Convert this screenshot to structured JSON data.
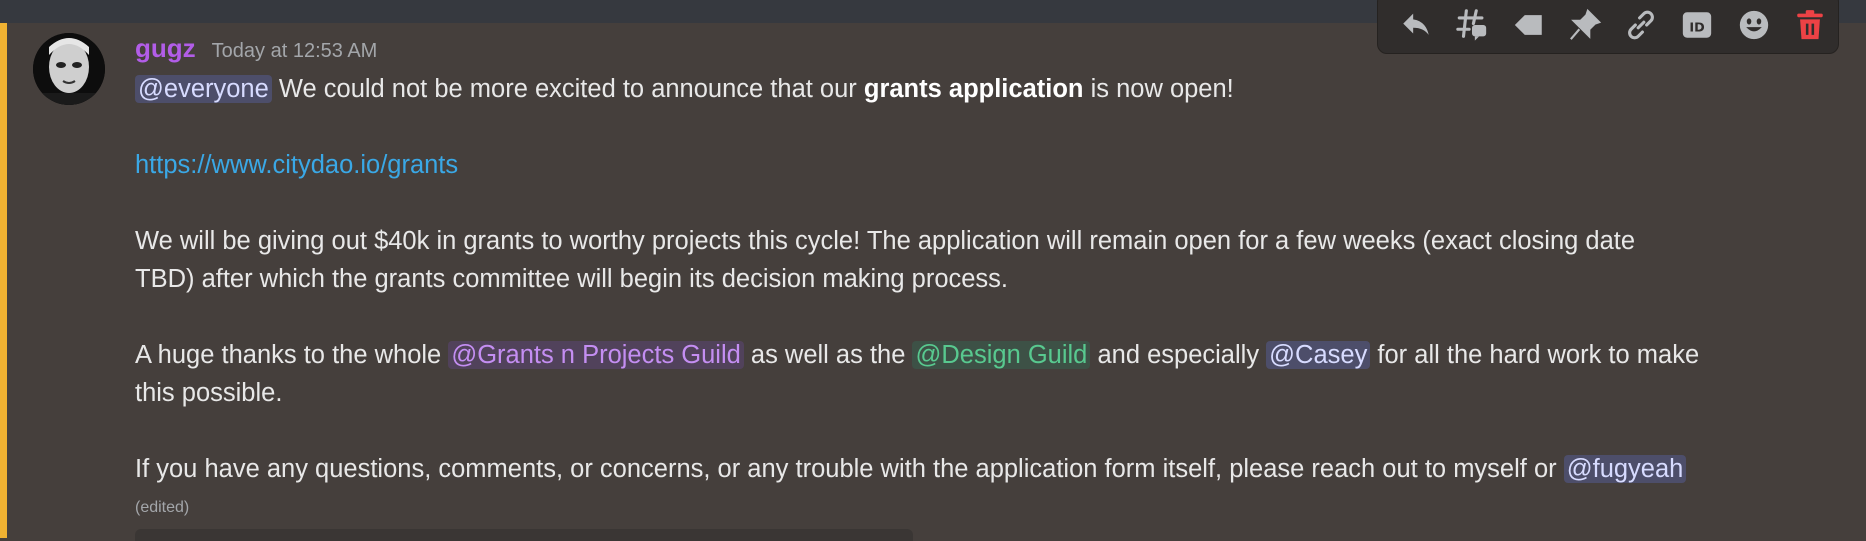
{
  "message": {
    "username": "gugz",
    "timestamp": "Today at 12:53 AM",
    "line1": {
      "mention": "@everyone",
      "pre_bold": " We could not be more excited to announce that our ",
      "bold": "grants application",
      "post_bold": " is now open!"
    },
    "link": "https://www.citydao.io/grants",
    "para2_line1": "We will be giving out $40k in grants to worthy projects this cycle! The application will remain open for a few weeks (exact closing date",
    "para2_line2": "TBD) after which the grants committee will begin its decision making process.",
    "para3": {
      "t1": "A huge thanks to the whole ",
      "mention1": "@Grants n Projects Guild",
      "t2": " as well as the ",
      "mention2": "@Design Guild",
      "t3": " and especially ",
      "mention3": "@Casey",
      "t4": " for all the hard work to make",
      "line2": "this possible."
    },
    "para4": {
      "text": "If you have any questions, comments, or concerns, or any trouble with the application form itself, please reach out to myself or ",
      "mention": "@fugyeah"
    },
    "edited": "(edited)"
  },
  "toolbar": {
    "icons": [
      "reply-icon",
      "create-thread-icon",
      "mark-unread-icon",
      "pin-icon",
      "copy-link-icon",
      "copy-id-icon",
      "add-reaction-icon",
      "delete-icon"
    ]
  },
  "colors": {
    "username": "#b25de8",
    "link": "#3aa8e6",
    "highlight_stripe": "#f0b232",
    "delete": "#ed4245"
  }
}
